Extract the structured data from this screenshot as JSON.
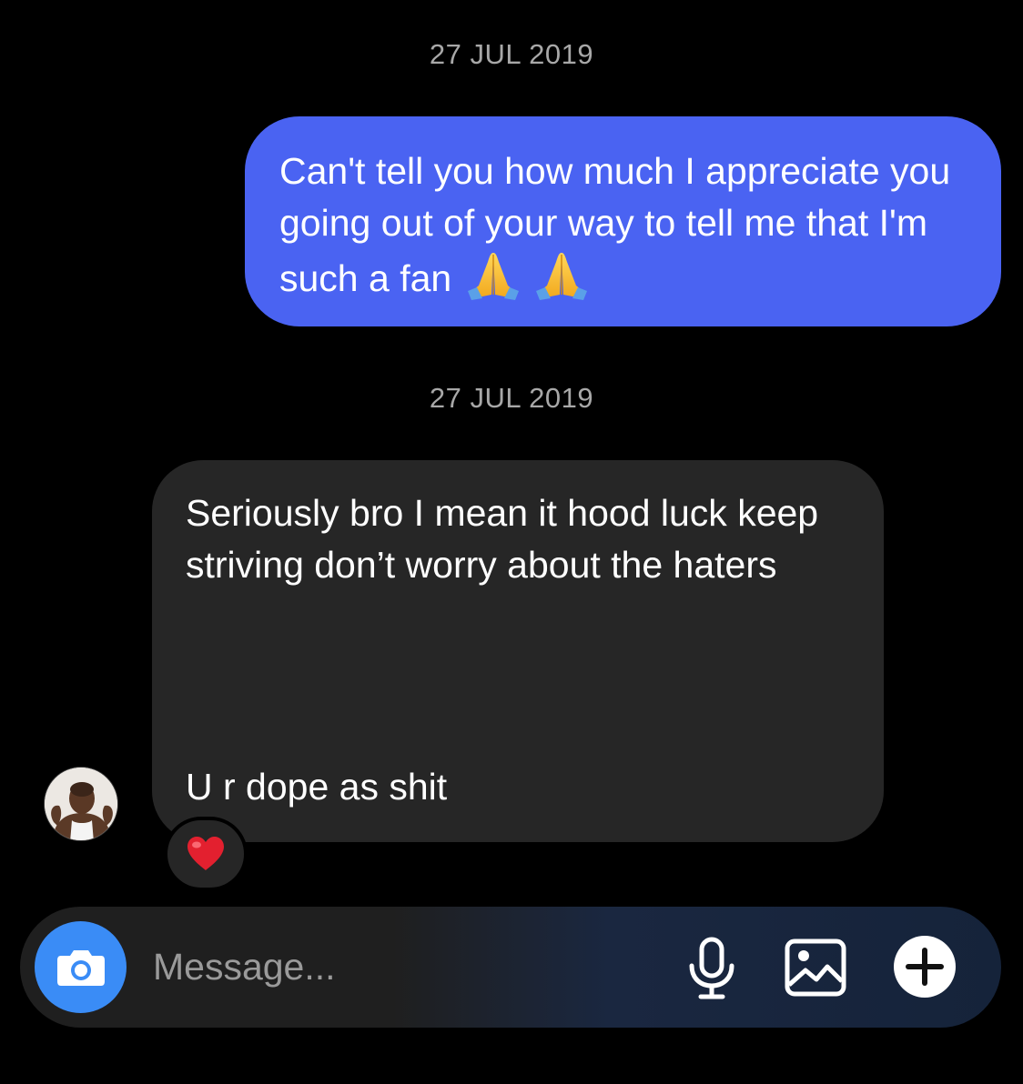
{
  "thread": {
    "messages": [
      {
        "timestamp": "27 JUL 2019",
        "direction": "sent",
        "text": "Can't tell you how much I appreciate you going out of your way to tell me that I'm such a fan",
        "emoji": "folded-hands-icon x2"
      },
      {
        "timestamp": "27 JUL 2019",
        "direction": "received",
        "text_line1": "Seriously bro I mean it hood luck keep striving don’t worry about the haters",
        "text_line2": "U r dope as shit",
        "reaction": "heart-icon"
      }
    ]
  },
  "composer": {
    "placeholder": "Message...",
    "value": ""
  },
  "colors": {
    "background": "#000000",
    "sent_bubble": "#4a63f2",
    "received_bubble": "#262626",
    "camera_button": "#3a8cf6",
    "timestamp_text": "#a8a8a8"
  }
}
